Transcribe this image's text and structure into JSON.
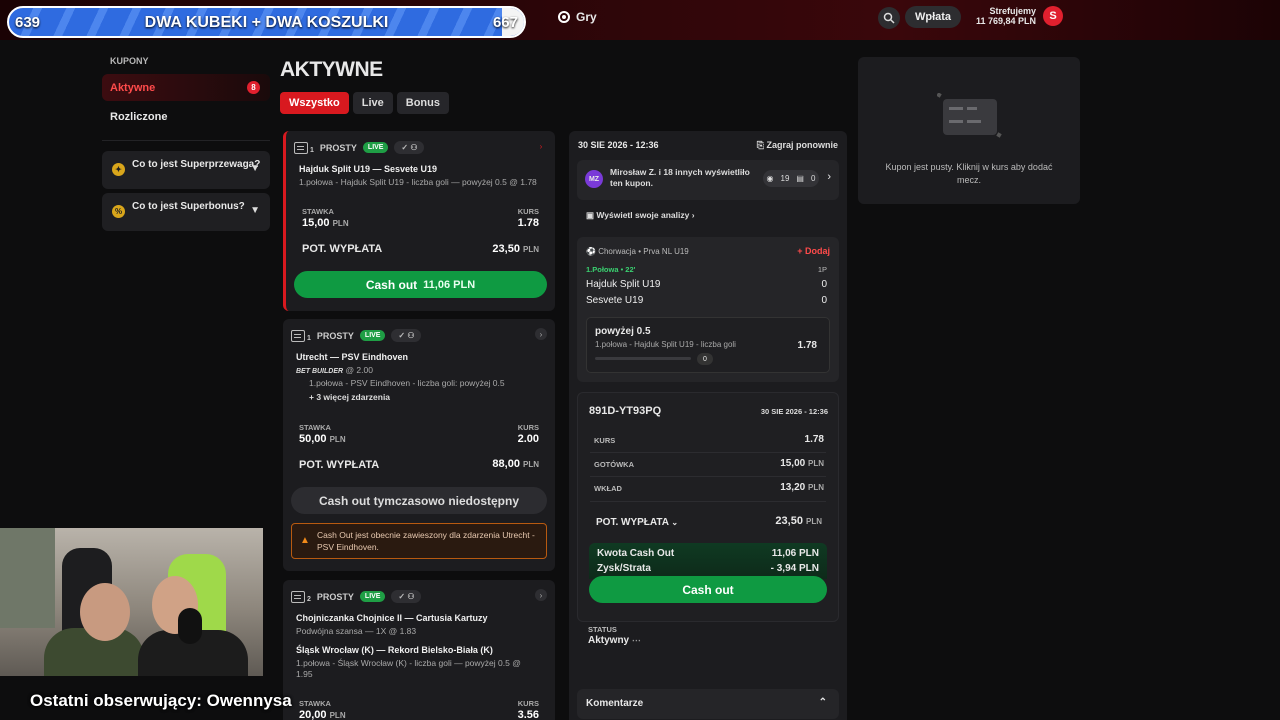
{
  "overlay": {
    "left_value": "639",
    "right_value": "667",
    "title": "DWA KUBEKI + DWA KOSZULKI",
    "progress_fraction": 0.958
  },
  "topbar": {
    "nav_games": "Gry",
    "deposit_label": "Wpłata",
    "user_name": "Strefujemy",
    "balance": "11 769,84 PLN",
    "avatar_letter": "S"
  },
  "sidebar": {
    "title": "KUPONY",
    "items": [
      {
        "label": "Aktywne",
        "count": "8"
      },
      {
        "label": "Rozliczone"
      }
    ],
    "info_cards": [
      {
        "label": "Co to jest Superprzewaga?",
        "icon": "shield-icon"
      },
      {
        "label": "Co to jest Superbonus?",
        "icon": "percent-icon"
      }
    ]
  },
  "page": {
    "title": "AKTYWNE",
    "tabs": [
      "Wszystko",
      "Live",
      "Bonus"
    ]
  },
  "bets": [
    {
      "slip_number": "1",
      "type": "PROSTY",
      "live": "LIVE",
      "match": "Hajduk Split U19 — Sesvete U19",
      "selection": "1.połowa - Hajduk Split U19 - liczba goli — powyżej 0.5 @ 1.78",
      "stake_label": "STAWKA",
      "stake": "15,00",
      "odds_label": "KURS",
      "odds": "1.78",
      "pot_label": "POT. WYPŁATA",
      "payout": "23,50",
      "currency": "PLN",
      "cashout_label": "Cash out",
      "cashout_value": "11,06 PLN"
    },
    {
      "slip_number": "1",
      "type": "PROSTY",
      "live": "LIVE",
      "match": "Utrecht — PSV Eindhoven",
      "bet_builder": "BET BUILDER",
      "bb_odds": "@ 2.00",
      "selection": "1.połowa - PSV Eindhoven - liczba goli: powyżej 0.5",
      "more": "+ 3 więcej zdarzenia",
      "stake_label": "STAWKA",
      "stake": "50,00",
      "odds_label": "KURS",
      "odds": "2.00",
      "pot_label": "POT. WYPŁATA",
      "payout": "88,00",
      "currency": "PLN",
      "cashout_disabled": "Cash out tymczasowo niedostępny",
      "warning": "Cash Out jest obecnie zawieszony dla zdarzenia Utrecht - PSV Eindhoven."
    },
    {
      "slip_number": "2",
      "type": "PROSTY",
      "live": "LIVE",
      "match": "Chojniczanka Chojnice II — Cartusia Kartuzy",
      "selection": "Podwójna szansa — 1X @ 1.83",
      "match2": "Śląsk Wrocław (K) — Rekord Bielsko-Biała (K)",
      "selection2": "1.połowa - Śląsk Wrocław (K) - liczba goli — powyżej 0.5 @ 1.95",
      "stake_label": "STAWKA",
      "stake": "20,00",
      "odds_label": "KURS",
      "odds": "3.56",
      "currency": "PLN"
    }
  ],
  "detail": {
    "date": "30 SIE 2026 - 12:36",
    "replay": "Zagraj ponownie",
    "viewer_avatar": "MZ",
    "viewers_text_1": "Mirosław Z. i 18 innych wyświetliło",
    "viewers_text_2": "ten kupon.",
    "views": "19",
    "copies": "0",
    "analyze": "Wyświetl swoje analizy",
    "league": "Chorwacja • Prva NL U19",
    "add": "+ Dodaj",
    "live_minute": "1.Połowa • 22'",
    "period": "1P",
    "home": "Hajduk Split U19",
    "away": "Sesvete U19",
    "home_score": "0",
    "away_score": "0",
    "selection_name": "powyżej 0.5",
    "selection_desc": "1.połowa - Hajduk Split U19 - liczba goli",
    "selection_odds": "1.78",
    "selection_count": "0",
    "code": "891D-YT93PQ",
    "code_date": "30 SIE 2026 - 12:36",
    "rows": [
      {
        "label": "KURS",
        "value": "1.78",
        "unit": ""
      },
      {
        "label": "GOTÓWKA",
        "value": "15,00",
        "unit": "PLN"
      },
      {
        "label": "WKŁAD",
        "value": "13,20",
        "unit": "PLN"
      }
    ],
    "pot_label": "POT. WYPŁATA",
    "pot_value": "23,50",
    "currency": "PLN",
    "cashout_amount_label": "Kwota Cash Out",
    "cashout_amount": "11,06 PLN",
    "profit_label": "Zysk/Strata",
    "profit": "- 3,94 PLN",
    "cashout_button": "Cash out",
    "status_label": "STATUS",
    "status": "Aktywny",
    "comments": "Komentarze"
  },
  "coupon": {
    "empty_text": "Kupon jest pusty. Kliknij w kurs aby dodać mecz."
  },
  "stream": {
    "follower_text": "Ostatni obserwujący: Owennysa"
  },
  "colors": {
    "accent": "#d8191f",
    "cashout": "#0f9a42",
    "live": "#1f9e45"
  }
}
